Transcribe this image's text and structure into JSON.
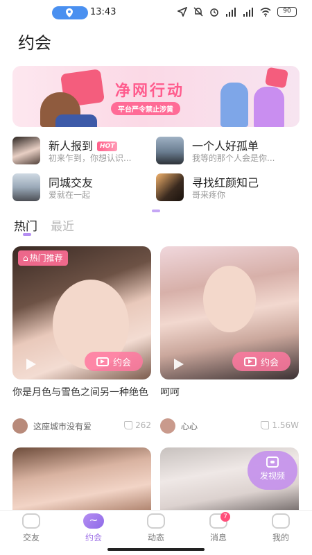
{
  "status_bar": {
    "time": "13:43",
    "battery": "90",
    "icons": [
      "location-icon",
      "send-icon",
      "bell-off-icon",
      "alarm-icon",
      "signal-icon",
      "signal-icon",
      "wifi-icon",
      "battery-icon"
    ]
  },
  "header": {
    "title": "约会"
  },
  "banner": {
    "title": "净网行动",
    "subtitle": "平台严令禁止涉黄"
  },
  "categories": [
    {
      "title": "新人报到",
      "badge": "HOT",
      "subtitle": "初来乍到，你想认识..."
    },
    {
      "title": "一个人好孤单",
      "subtitle": "我等的那个人会是你..."
    },
    {
      "title": "同城交友",
      "subtitle": "爱就在一起"
    },
    {
      "title": "寻找红颜知己",
      "subtitle": "哥来疼你"
    }
  ],
  "tabs": [
    {
      "label": "热门",
      "active": true
    },
    {
      "label": "最近",
      "active": false
    }
  ],
  "cards": [
    {
      "tag": "热门推荐",
      "button_label": "约会",
      "description": "你是月色与雪色之间另一种绝色",
      "username": "这座城市没有爱",
      "likes": "262"
    },
    {
      "button_label": "约会",
      "description": "呵呵",
      "username": "心心",
      "likes": "1.56W"
    }
  ],
  "fab": {
    "label": "发视频"
  },
  "bottom_nav": [
    {
      "label": "交友",
      "icon": "home-icon",
      "active": false
    },
    {
      "label": "约会",
      "icon": "date-icon",
      "active": true
    },
    {
      "label": "动态",
      "icon": "moments-icon",
      "active": false
    },
    {
      "label": "消息",
      "icon": "message-icon",
      "active": false,
      "badge": "7"
    },
    {
      "label": "我的",
      "icon": "profile-icon",
      "active": false
    }
  ],
  "colors": {
    "accent": "#9a6be6",
    "pink": "#ff6b96",
    "badge": "#ff4f7a"
  }
}
